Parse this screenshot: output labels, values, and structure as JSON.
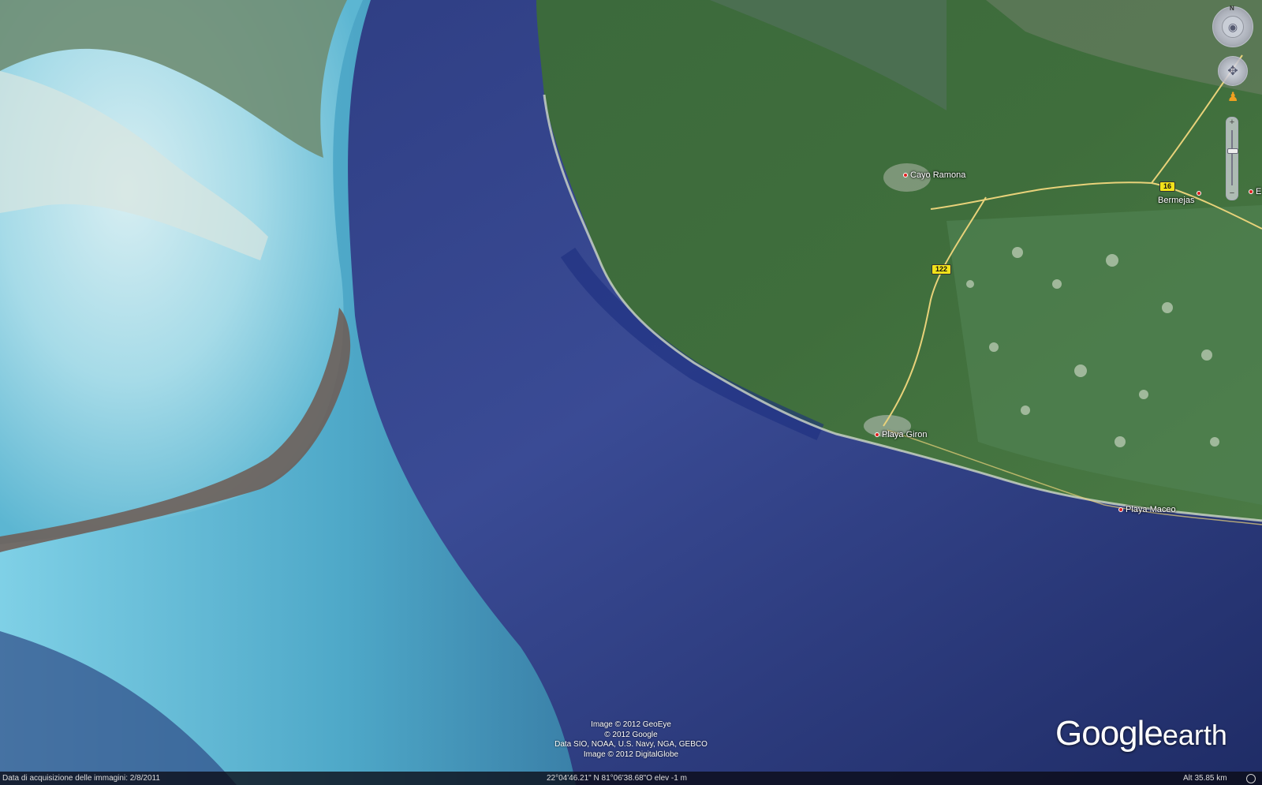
{
  "app": {
    "name": "Google earth"
  },
  "places": [
    {
      "id": "cayo-ramona",
      "label": "Cayo Ramona"
    },
    {
      "id": "bermejas",
      "label": "Bermejas"
    },
    {
      "id": "playa-giron",
      "label": "Playa Giron"
    },
    {
      "id": "playa-maceo",
      "label": "Playa Maceo"
    },
    {
      "id": "edge",
      "label": "E"
    }
  ],
  "roads": [
    {
      "id": "road-16",
      "label": "16"
    },
    {
      "id": "road-122",
      "label": "122"
    }
  ],
  "attribution": [
    "Image © 2012 GeoEye",
    "© 2012 Google",
    "Data SIO, NOAA, U.S. Navy, NGA, GEBCO",
    "Image © 2012 DigitalGlobe"
  ],
  "logo": {
    "google": "Google",
    "earth": "earth"
  },
  "status": {
    "imagery_date": "Data di acquisizione delle immagini: 2/8/2011",
    "coords": "22°04'46.21\" N  81°06'38.68\"O  elev   -1 m",
    "alt": "Alt    35.85 km"
  },
  "nav": {
    "north": "N",
    "zoom_in": "+",
    "zoom_out": "−",
    "zoom_level": 0.65
  },
  "icons": {
    "look": "eye-icon",
    "move": "hand-icon",
    "pegman": "pegman-icon",
    "place_pin": "red-pin-icon"
  },
  "colors": {
    "deep_water": "#2a3878",
    "shallow_water": "#5ab4d0",
    "land": "#3e6a3a",
    "road": "#e8d27a",
    "pin": "#e02020"
  }
}
